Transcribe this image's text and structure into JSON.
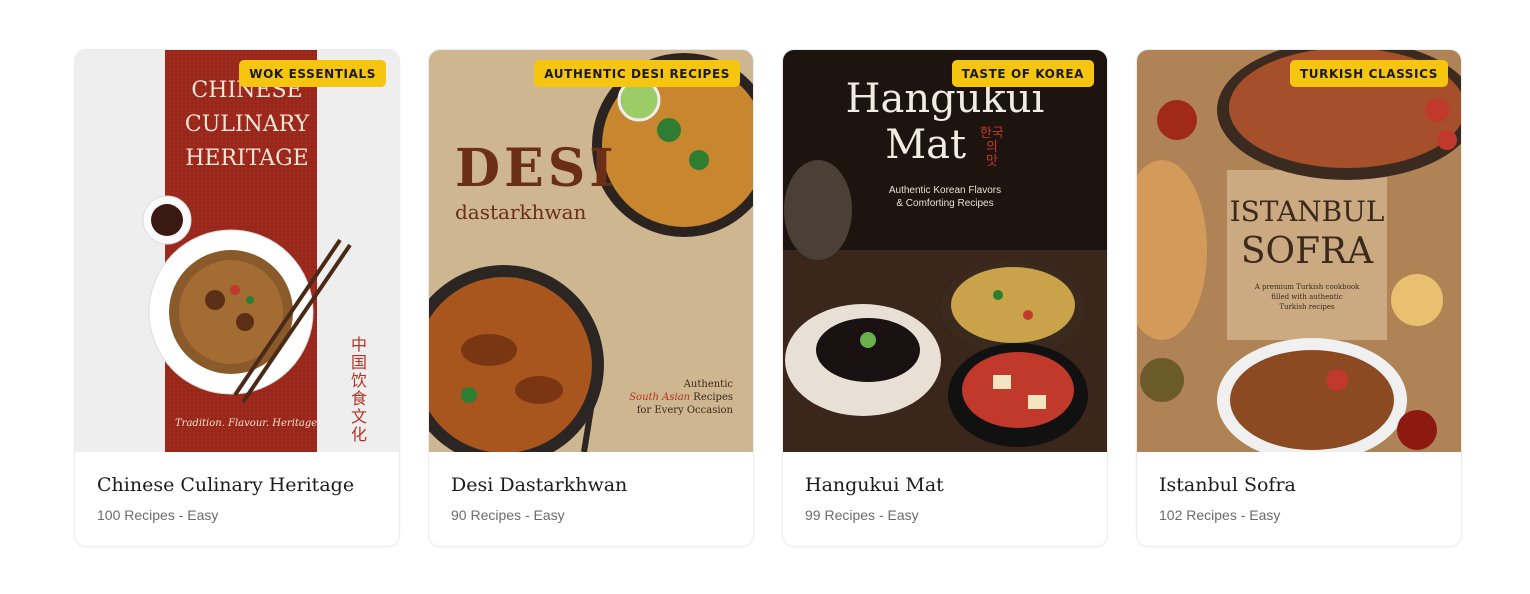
{
  "cards": [
    {
      "badge": "WOK ESSENTIALS",
      "title": "Chinese Culinary Heritage",
      "recipes": "100 Recipes",
      "sep": "-",
      "difficulty": "Easy",
      "cover": {
        "line1": "CHINESE",
        "line2": "CULINARY",
        "line3": "HERITAGE",
        "tagline": "Tradition. Flavour. Heritage.",
        "vertical": "中国饮食文化"
      }
    },
    {
      "badge": "AUTHENTIC DESI RECIPES",
      "title": "Desi Dastarkhwan",
      "recipes": "90 Recipes",
      "sep": "-",
      "difficulty": "Easy",
      "cover": {
        "big": "DESI",
        "sub": "dastarkhwan",
        "note1": "Authentic",
        "note2": "South Asian",
        "note2b": "Recipes",
        "note3": "for Every Occasion"
      }
    },
    {
      "badge": "TASTE OF KOREA",
      "title": "Hangukui Mat",
      "recipes": "99 Recipes",
      "sep": "-",
      "difficulty": "Easy",
      "cover": {
        "line1": "Hangukui",
        "line2": "Mat",
        "korean": "한국의 맛",
        "sub1": "Authentic Korean Flavors",
        "sub2": "& Comforting Recipes"
      }
    },
    {
      "badge": "TURKISH CLASSICS",
      "title": "Istanbul Sofra",
      "recipes": "102 Recipes",
      "sep": "-",
      "difficulty": "Easy",
      "cover": {
        "line1": "ISTANBUL",
        "line2": "SOFRA",
        "sub1": "A premium Turkish cookbook",
        "sub2": "filled with authentic",
        "sub3": "Turkish recipes"
      }
    }
  ],
  "colors": {
    "badge": "#f6c50f",
    "chinese_red": "#9e2a1e",
    "desi_wood": "#c9b08a",
    "korea_dark": "#1d1410",
    "turkish_wood": "#b08356"
  }
}
